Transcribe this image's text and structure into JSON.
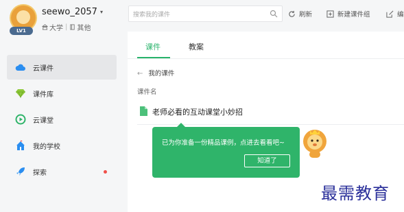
{
  "profile": {
    "username": "seewo_2057",
    "level_badge": "LV1",
    "school_type": "大学",
    "subject": "其他"
  },
  "sidebar": {
    "items": [
      {
        "label": "云课件",
        "icon": "cloud-icon",
        "active": true
      },
      {
        "label": "课件库",
        "icon": "diamond-icon",
        "active": false
      },
      {
        "label": "云课堂",
        "icon": "play-circle-icon",
        "active": false
      },
      {
        "label": "我的学校",
        "icon": "school-icon",
        "active": false
      },
      {
        "label": "探索",
        "icon": "rocket-icon",
        "active": false,
        "has_dot": true
      }
    ]
  },
  "topbar": {
    "search_placeholder": "搜索我的课件",
    "refresh_label": "刷新",
    "new_group_label": "新建课件组",
    "edit_label": "编"
  },
  "main": {
    "tabs": [
      {
        "label": "课件",
        "active": true
      },
      {
        "label": "教案",
        "active": false
      }
    ],
    "breadcrumb": "我的课件",
    "column_header": "课件名",
    "files": [
      {
        "name": "老师必看的互动课堂小妙招",
        "icon": "file-icon"
      }
    ]
  },
  "popup": {
    "message": "已为你准备一份精品课例，点进去看看吧~",
    "button_label": "知道了"
  },
  "watermark": "最需教育",
  "colors": {
    "accent": "#27b36a",
    "popup_bg": "#2fb46a",
    "notification_dot": "#f0504a",
    "watermark": "#2a2f9a"
  }
}
